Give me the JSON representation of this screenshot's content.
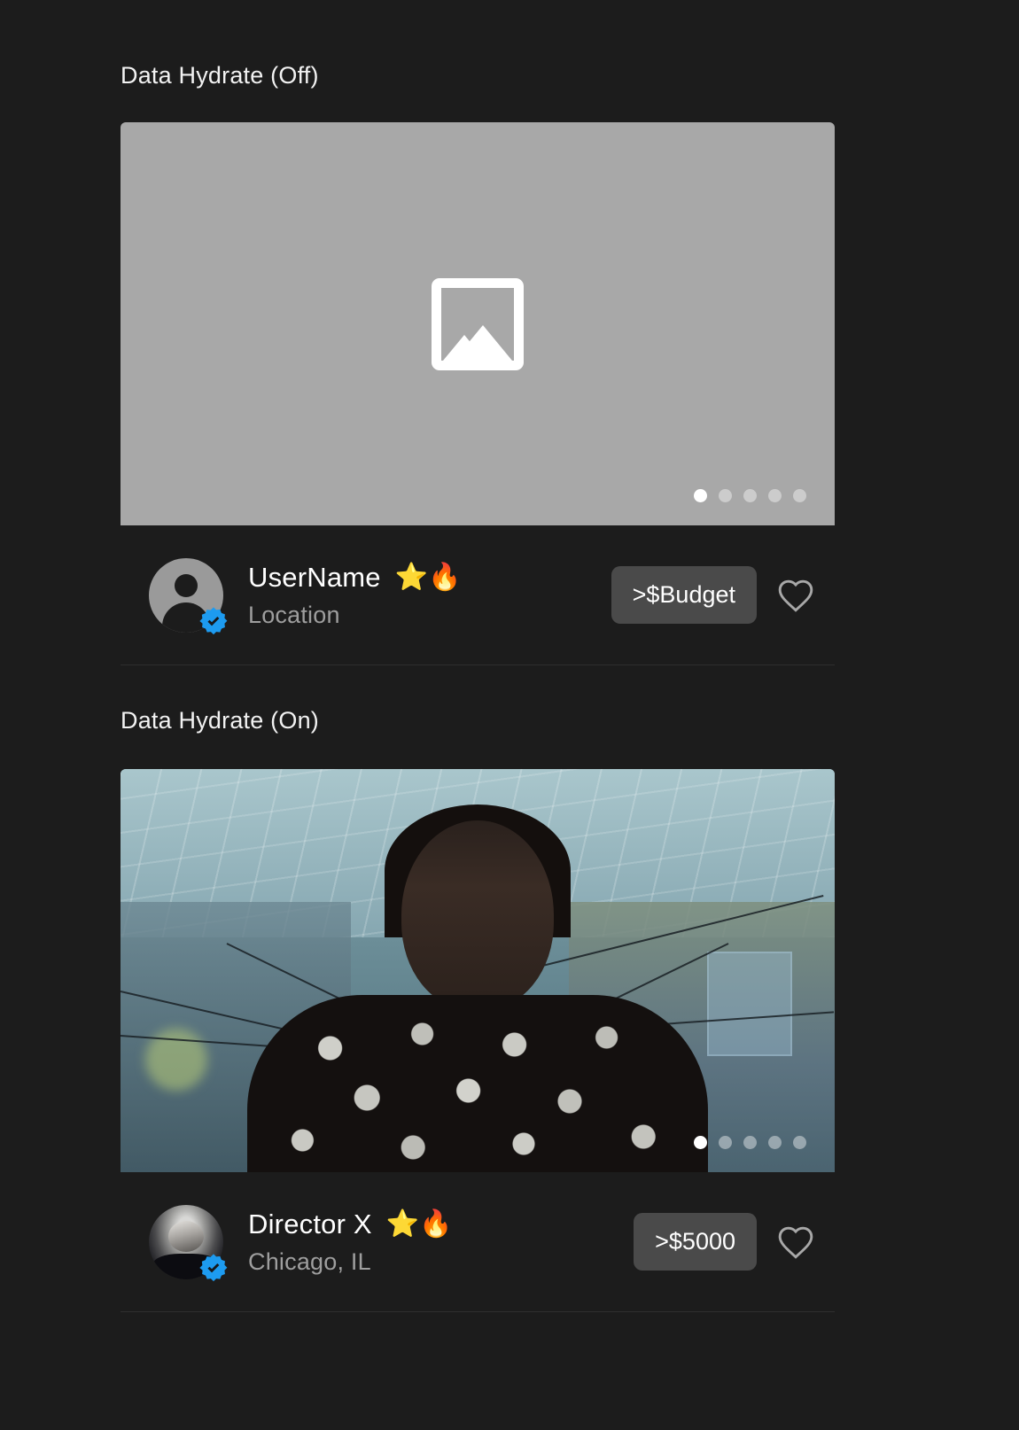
{
  "page": {
    "background_color": "#1c1c1c",
    "accent_verified_color": "#1d9bf0",
    "button_color": "#4a4a4a"
  },
  "sections": [
    {
      "label": "Data Hydrate (Off)",
      "card": {
        "media_type": "placeholder",
        "media_icon": "image-placeholder-icon",
        "media_background": "#a8a8a8",
        "carousel": {
          "total": 5,
          "active_index": 0
        },
        "avatar_type": "person-silhouette-icon",
        "verified": true,
        "username": "UserName",
        "badges": "⭐🔥",
        "location": "Location",
        "budget_label": ">$Budget",
        "favorite_icon": "heart-outline-icon",
        "favorited": false
      }
    },
    {
      "label": "Data Hydrate (On)",
      "card": {
        "media_type": "photo",
        "media_icon": "",
        "media_background": "#53707e",
        "carousel": {
          "total": 5,
          "active_index": 0
        },
        "avatar_type": "profile-photo",
        "verified": true,
        "username": "Director X",
        "badges": "⭐🔥",
        "location": "Chicago, IL",
        "budget_label": ">$5000",
        "favorite_icon": "heart-outline-icon",
        "favorited": false
      }
    }
  ]
}
